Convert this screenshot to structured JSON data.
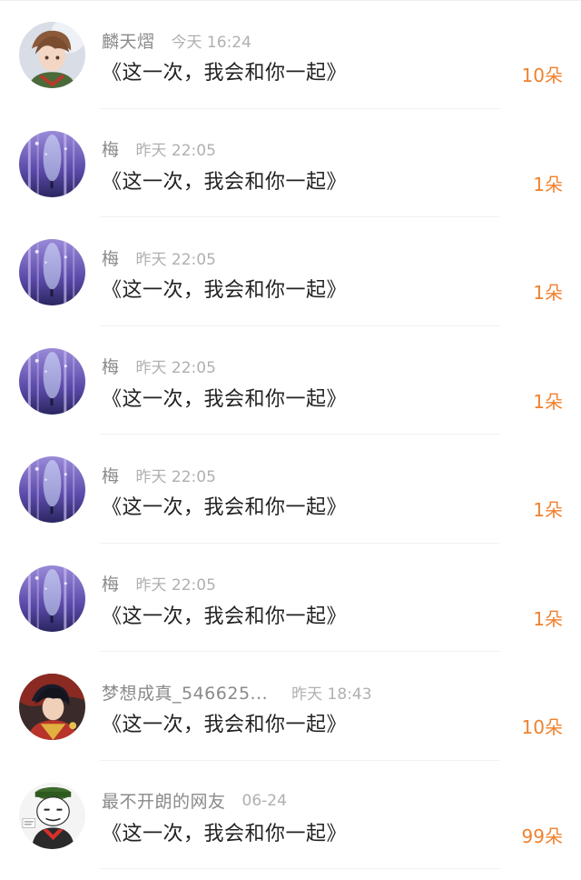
{
  "colors": {
    "gift": "#f0812e",
    "name": "#8a8a8a",
    "time": "#b0b0b0",
    "content": "#222222"
  },
  "items": [
    {
      "name": "麟天熠",
      "time": "今天 16:24",
      "content": "《这一次，我会和你一起》",
      "gift": "10朵",
      "avatar": "anime-boy-avatar"
    },
    {
      "name": "梅",
      "time": "昨天 22:05",
      "content": "《这一次，我会和你一起》",
      "gift": "1朵",
      "avatar": "forest-avatar"
    },
    {
      "name": "梅",
      "time": "昨天 22:05",
      "content": "《这一次，我会和你一起》",
      "gift": "1朵",
      "avatar": "forest-avatar"
    },
    {
      "name": "梅",
      "time": "昨天 22:05",
      "content": "《这一次，我会和你一起》",
      "gift": "1朵",
      "avatar": "forest-avatar"
    },
    {
      "name": "梅",
      "time": "昨天 22:05",
      "content": "《这一次，我会和你一起》",
      "gift": "1朵",
      "avatar": "forest-avatar"
    },
    {
      "name": "梅",
      "time": "昨天 22:05",
      "content": "《这一次，我会和你一起》",
      "gift": "1朵",
      "avatar": "forest-avatar"
    },
    {
      "name": "梦想成真_546625...",
      "time": "昨天 18:43",
      "content": "《这一次，我会和你一起》",
      "gift": "10朵",
      "avatar": "anime-warrior-avatar"
    },
    {
      "name": "最不开朗的网友",
      "time": "06-24",
      "content": "《这一次，我会和你一起》",
      "gift": "99朵",
      "avatar": "meme-face-avatar"
    }
  ]
}
